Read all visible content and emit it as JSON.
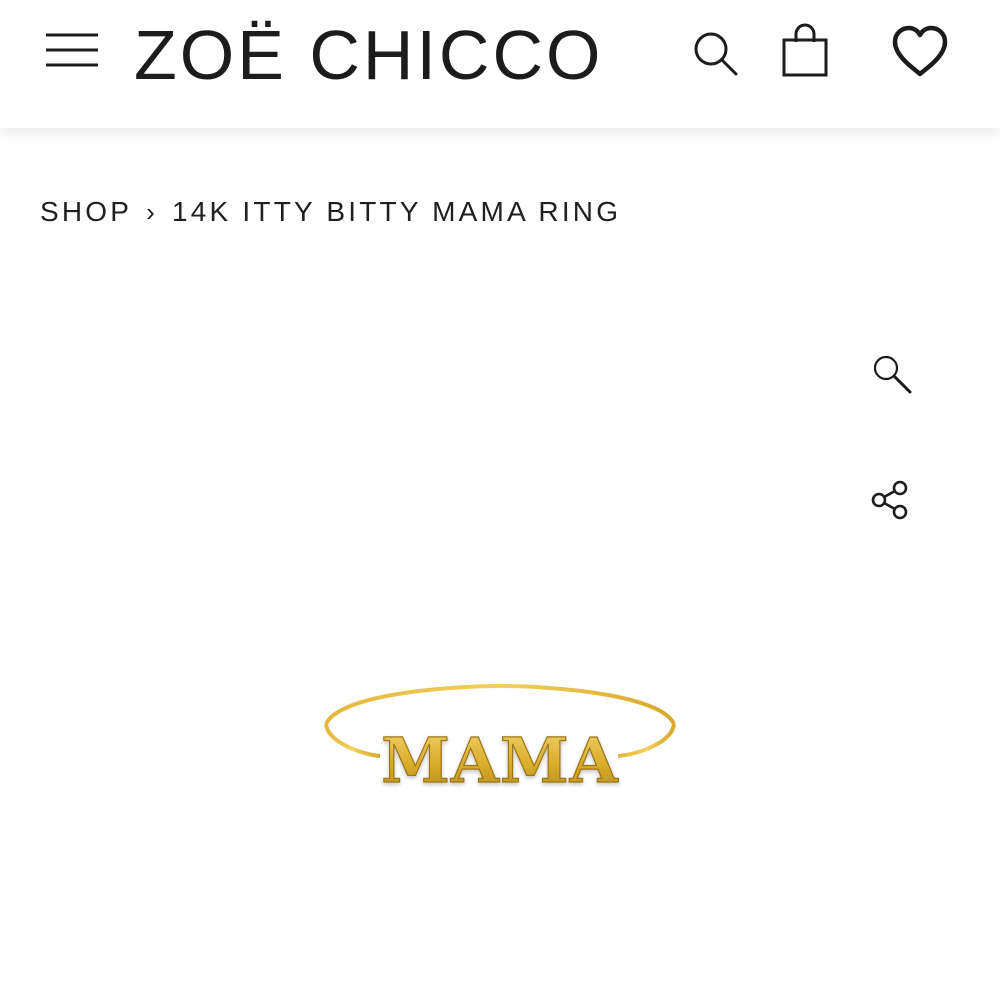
{
  "header": {
    "logo_text": "ZOË CHICCO",
    "menu_icon": "hamburger-menu-icon",
    "search_icon": "search-icon",
    "bag_icon": "shopping-bag-icon",
    "wishlist_icon": "heart-icon"
  },
  "breadcrumb": {
    "shop_label": "SHOP",
    "separator": "›",
    "current_label": "14K ITTY BITTY MAMA RING"
  },
  "product": {
    "image_text": "MAMA",
    "zoom_icon": "zoom-icon",
    "share_icon": "share-icon"
  },
  "colors": {
    "text": "#1c1c1c",
    "gold_light": "#f3d36a",
    "gold_mid": "#d9ac2a",
    "gold_dark": "#a67c12"
  }
}
